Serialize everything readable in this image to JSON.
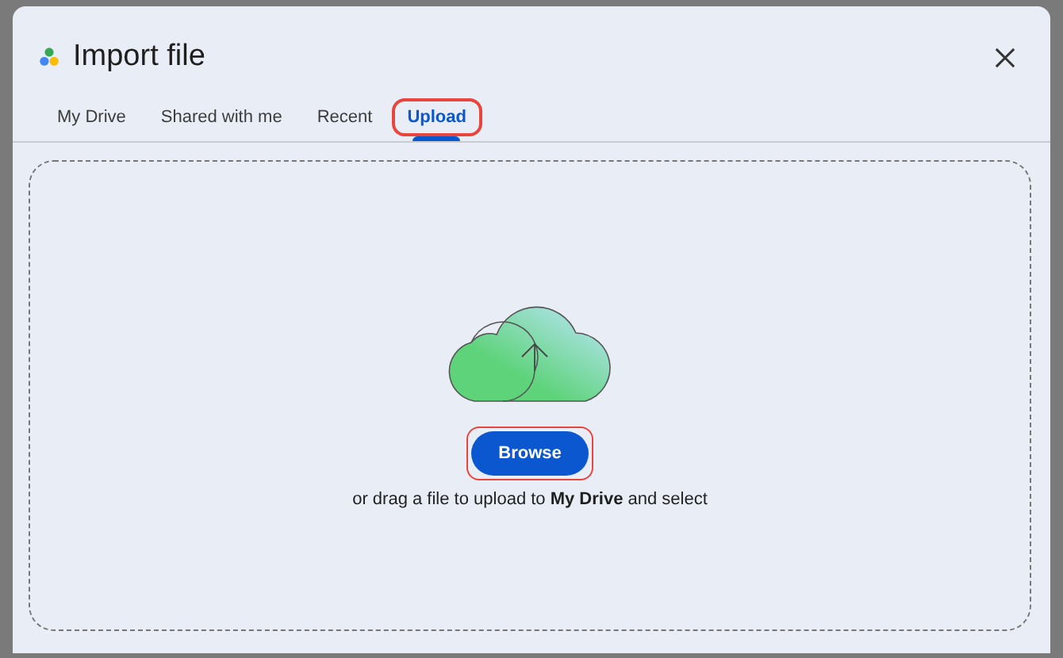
{
  "dialog": {
    "title": "Import file"
  },
  "tabs": [
    {
      "label": "My Drive",
      "selected": false,
      "highlighted": false
    },
    {
      "label": "Shared with me",
      "selected": false,
      "highlighted": false
    },
    {
      "label": "Recent",
      "selected": false,
      "highlighted": false
    },
    {
      "label": "Upload",
      "selected": true,
      "highlighted": true
    }
  ],
  "upload": {
    "button": {
      "label": "Browse",
      "highlighted": true
    },
    "hint": "or drag a file to upload to **My Drive** and select"
  }
}
